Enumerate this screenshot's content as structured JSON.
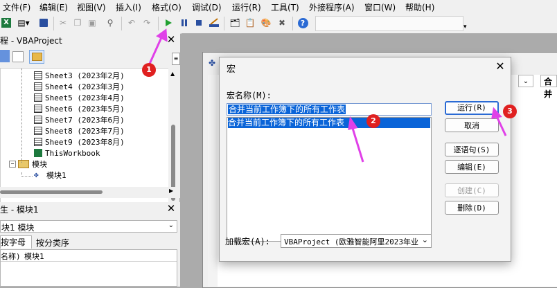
{
  "menu": [
    "文件(F)",
    "编辑(E)",
    "视图(V)",
    "插入(I)",
    "格式(O)",
    "调试(D)",
    "运行(R)",
    "工具(T)",
    "外接程序(A)",
    "窗口(W)",
    "帮助(H)"
  ],
  "project_explorer": {
    "title": "程 - VBAProject",
    "items": [
      {
        "label": "Sheet3 (2023年2月)",
        "type": "sheet"
      },
      {
        "label": "Sheet4 (2023年3月)",
        "type": "sheet"
      },
      {
        "label": "Sheet5 (2023年4月)",
        "type": "sheet"
      },
      {
        "label": "Sheet6 (2023年5月)",
        "type": "sheet"
      },
      {
        "label": "Sheet7 (2023年6月)",
        "type": "sheet"
      },
      {
        "label": "Sheet8 (2023年7月)",
        "type": "sheet"
      },
      {
        "label": "Sheet9 (2023年8月)",
        "type": "sheet"
      },
      {
        "label": "ThisWorkbook",
        "type": "workbook"
      },
      {
        "label": "模块",
        "type": "folder"
      },
      {
        "label": "模块1",
        "type": "module"
      }
    ]
  },
  "properties": {
    "title": "生 - 模块1",
    "object_select": "块1 模块",
    "tabs": [
      "按字母序",
      "按分类序"
    ],
    "row_label": "名称)",
    "row_value": "模块1"
  },
  "code_window": {
    "right_field": "合并"
  },
  "dialog": {
    "title": "宏",
    "macro_name_label": "宏名称(M):",
    "macro_name_value": "合并当前工作簿下的所有工作表",
    "list_items": [
      "合并当前工作簿下的所有工作表"
    ],
    "buttons": {
      "run": "运行(R)",
      "cancel": "取消",
      "step": "逐语句(S)",
      "edit": "编辑(E)",
      "create": "创建(C)",
      "delete": "删除(D)"
    },
    "macros_in_label": "加载宏(A):",
    "macros_in_value": "VBAProject (欧雅智能阿里2023年业"
  },
  "annotations": [
    "1",
    "2",
    "3"
  ],
  "colors": {
    "selection": "#0a64d8",
    "marker": "#e02020",
    "arrow": "#e040e8",
    "run_icon": "#22a032"
  }
}
